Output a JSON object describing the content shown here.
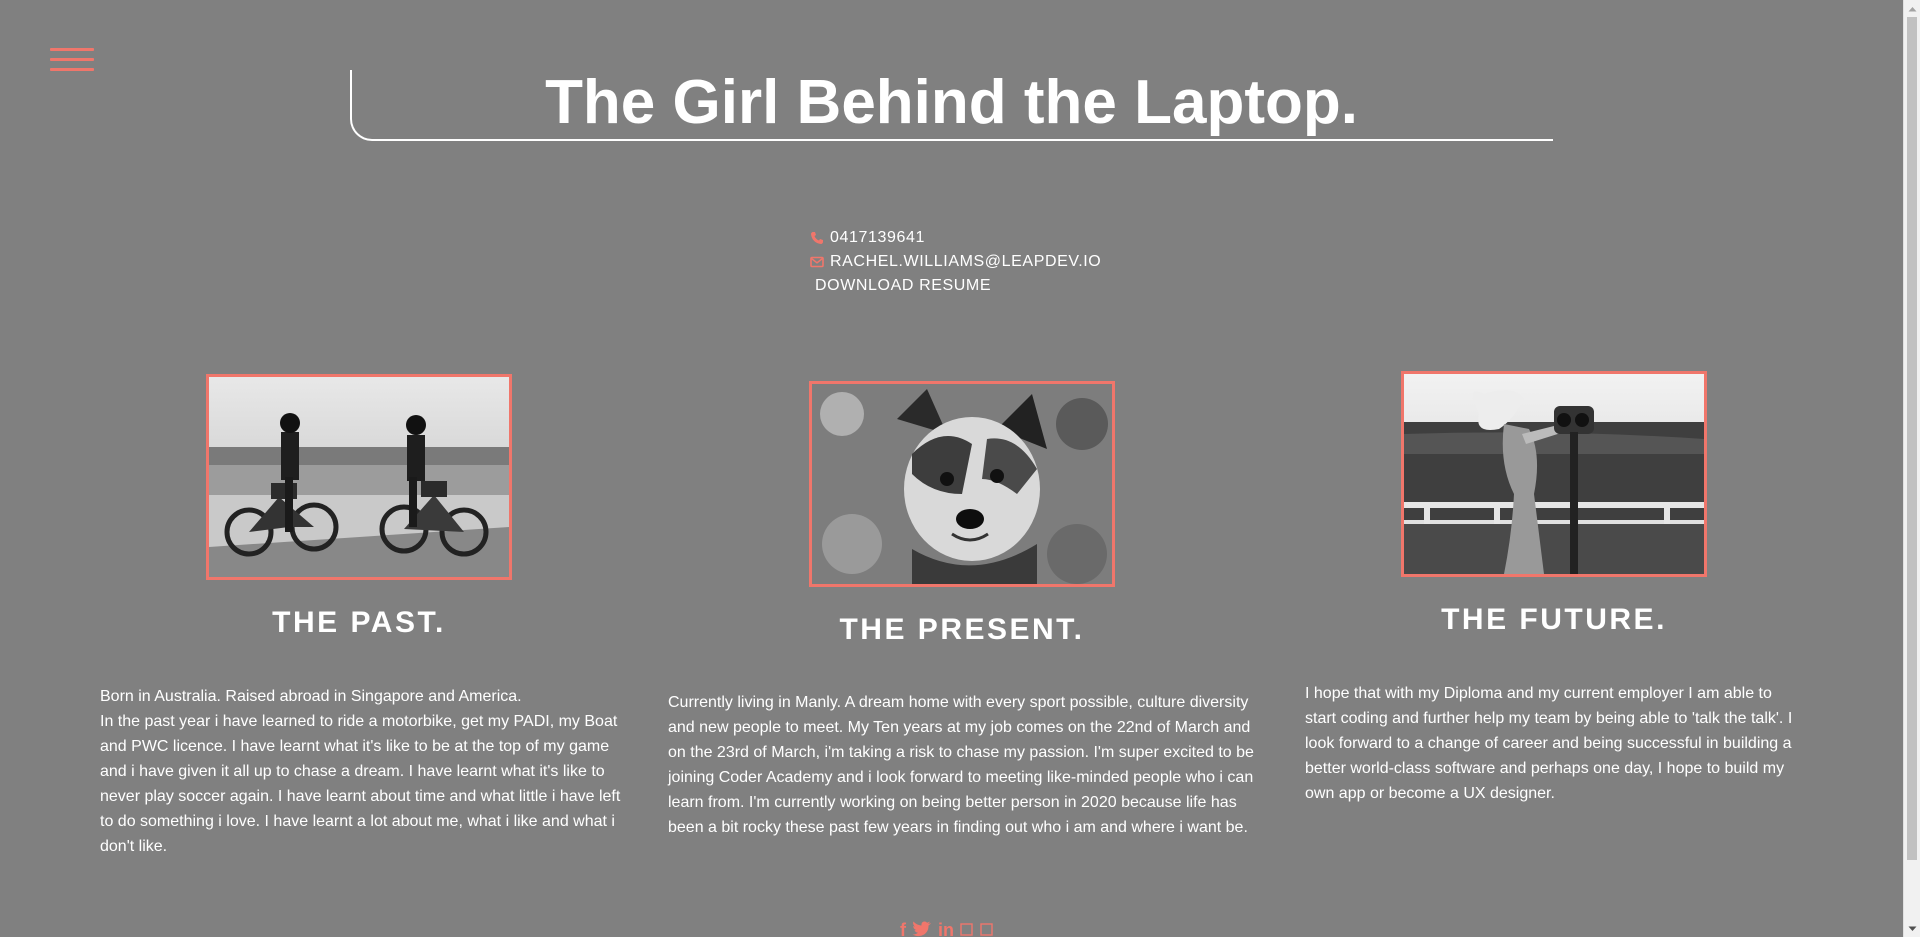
{
  "header": {
    "title": "The Girl Behind the Laptop."
  },
  "contact": {
    "phone": "0417139641",
    "email": "RACHEL.WILLIAMS@LEAPDEV.IO",
    "download_label": "DOWNLOAD RESUME"
  },
  "sections": [
    {
      "heading": "THE PAST.",
      "image_icon": "motorbikes-photo",
      "text_1": "Born in Australia. Raised abroad in Singapore and America.",
      "text_2": "In the past year i have learned to ride a motorbike, get my PADI, my Boat and PWC licence. I have learnt what it's like to be at the top of my game and i have given it all up to chase a dream. I have learnt what it's like to never play soccer again. I have learnt about time and what little i have left to do something i love. I have learnt a lot about me, what i like and what i don't like."
    },
    {
      "heading": "THE PRESENT.",
      "image_icon": "dog-photo",
      "text_1": "Currently living in Manly. A dream home with every sport possible, culture diversity and new people to meet. My Ten years at my job comes on the 22nd of March and on the 23rd of March, i'm taking a risk to chase my passion. I'm super excited to be joining Coder Academy and i look forward to meeting like-minded people who i can learn from. I'm currently working on being better person in 2020 because life has been a bit rocky these past few years in finding out who i am and where i want be."
    },
    {
      "heading": "THE FUTURE.",
      "image_icon": "binoculars-photo",
      "text_1": "I hope that with my Diploma and my current employer I am able to start coding and further help my team by being able to 'talk the talk'. I look forward to a change of career and being successful in building a better world-class software and perhaps one day, I hope to build my own app or become a UX designer."
    }
  ],
  "social": {
    "icons": [
      "facebook-icon",
      "twitter-icon",
      "linkedin-icon",
      "github-icon",
      "instagram-icon"
    ],
    "facebook": "f",
    "linkedin": "in"
  },
  "colors": {
    "background": "#808080",
    "accent": "#f0766b",
    "text": "#ffffff"
  }
}
